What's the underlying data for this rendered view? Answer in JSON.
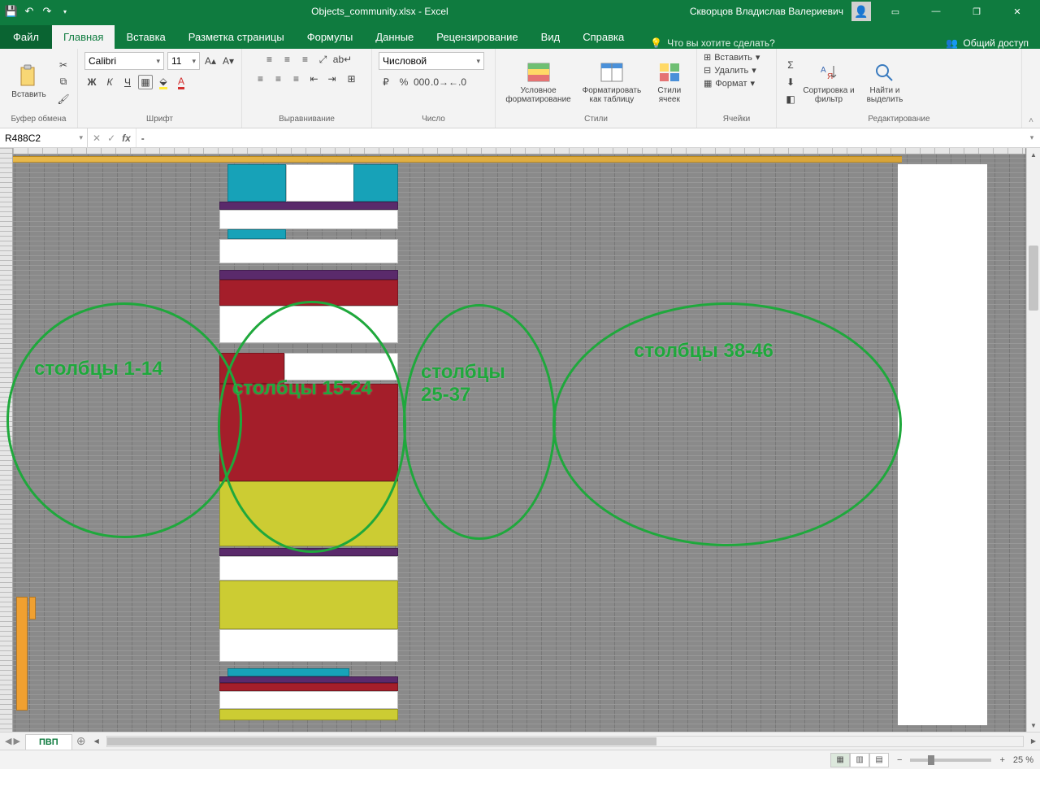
{
  "title": "Objects_community.xlsx - Excel",
  "user": "Скворцов Владислав Валериевич",
  "qat": {
    "save": "save",
    "undo": "undo",
    "redo": "redo"
  },
  "tabs": {
    "file": "Файл",
    "items": [
      "Главная",
      "Вставка",
      "Разметка страницы",
      "Формулы",
      "Данные",
      "Рецензирование",
      "Вид",
      "Справка"
    ],
    "active": 0,
    "tell_me": "Что вы хотите сделать?",
    "share": "Общий доступ"
  },
  "ribbon": {
    "clipboard": {
      "paste": "Вставить",
      "label": "Буфер обмена"
    },
    "font": {
      "name": "Calibri",
      "size": "11",
      "label": "Шрифт",
      "bold": "Ж",
      "italic": "К",
      "underline": "Ч"
    },
    "align": {
      "label": "Выравнивание",
      "wrap": "Перенести текст",
      "merge": "Объединить"
    },
    "number": {
      "format": "Числовой",
      "label": "Число"
    },
    "styles": {
      "cond": "Условное форматирование",
      "table": "Форматировать как таблицу",
      "cell": "Стили ячеек",
      "label": "Стили"
    },
    "cells": {
      "insert": "Вставить",
      "delete": "Удалить",
      "format": "Формат",
      "label": "Ячейки"
    },
    "editing": {
      "sort": "Сортировка и фильтр",
      "find": "Найти и выделить",
      "label": "Редактирование"
    }
  },
  "namebox": "R488C2",
  "formula": "-",
  "annotations": {
    "e1": "столбцы 1-14",
    "e2": "столбцы 15-24",
    "e3": "столбцы 25-37",
    "e4": "столбцы 38-46"
  },
  "sheet_tab": "ПВП",
  "status": {
    "zoom": "25 %",
    "minus": "−",
    "plus": "+"
  }
}
